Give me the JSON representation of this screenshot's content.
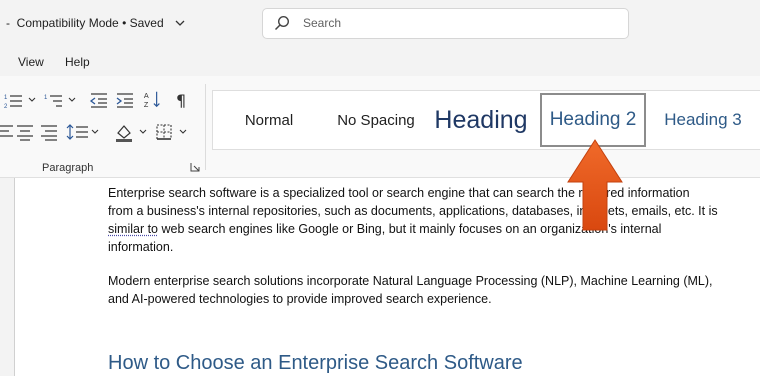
{
  "titlebar": {
    "prefix": "-",
    "mode": "Compatibility Mode",
    "bullet": "•",
    "status": "Saved"
  },
  "search": {
    "placeholder": "Search"
  },
  "menu": {
    "items": [
      "View",
      "Help"
    ]
  },
  "ribbon": {
    "group_label": "Paragraph",
    "styles": [
      "Normal",
      "No Spacing",
      "Heading",
      "Heading 2",
      "Heading 3"
    ]
  },
  "document": {
    "para1_a": "Enterprise search software is a specialized tool or search engine that can search the required information from a business's internal repositories, such as documents, applications, databases, intranets, emails, etc. It is ",
    "para1_squiggle": "similar to",
    "para1_b": " web search engines like Google or Bing, but it mainly focuses on an organization's internal information.",
    "para2": "Modern enterprise search solutions incorporate Natural Language Processing (NLP), Machine Learning (ML), and AI-powered technologies to provide improved search experience.",
    "heading": "How to Choose an Enterprise Search Software"
  },
  "colors": {
    "arrow": "#e8571d",
    "heading": "#2e5a87"
  }
}
